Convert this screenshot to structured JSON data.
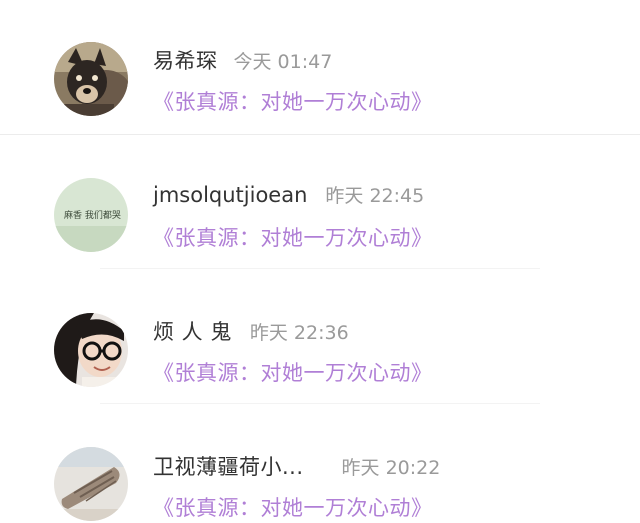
{
  "comments": [
    {
      "name": "易希琛",
      "time": "今天 01:47",
      "title": "《张真源：对她一万次心动》",
      "avatar": "dog-photo"
    },
    {
      "name": "jmsolqutjioean",
      "time": "昨天 22:45",
      "title": "《张真源：对她一万次心动》",
      "avatar": "green-note-photo",
      "avatar_text": "麻香 我们都哭"
    },
    {
      "name": "烦 人 鬼",
      "time": "昨天 22:36",
      "title": "《张真源：对她一万次心动》",
      "avatar": "girl-glasses-photo"
    },
    {
      "name": "卫视薄疆荷小...",
      "time": "昨天 20:22",
      "title": "《张真源：对她一万次心动》",
      "avatar": "shell-photo"
    }
  ],
  "colors": {
    "title": "#b07fd6",
    "name": "#333333",
    "time": "#9a9a9a",
    "divider": "#ececec"
  }
}
